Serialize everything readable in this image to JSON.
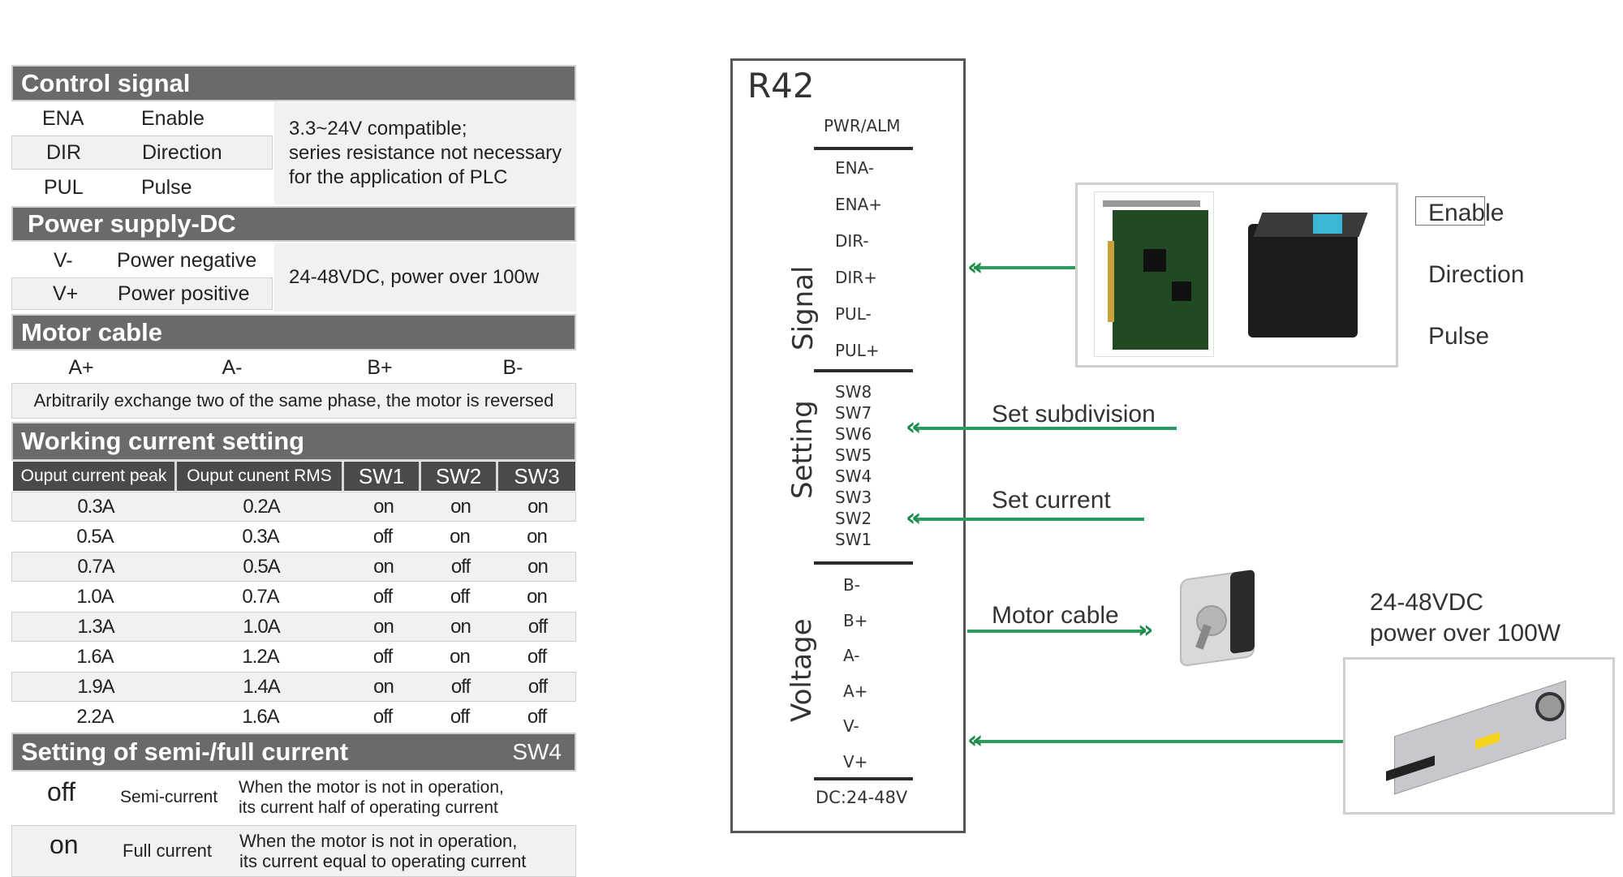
{
  "control_signal": {
    "title": "Control signal",
    "rows": [
      {
        "code": "ENA",
        "name": "Enable"
      },
      {
        "code": "DIR",
        "name": "Direction"
      },
      {
        "code": "PUL",
        "name": "Pulse"
      }
    ],
    "note_lines": [
      "3.3~24V compatible;",
      "series resistance not necessary",
      "for the application of PLC"
    ]
  },
  "power_supply": {
    "title": "Power supply-DC",
    "rows": [
      {
        "code": "V-",
        "name": "Power negative"
      },
      {
        "code": "V+",
        "name": "Power positive"
      }
    ],
    "note": "24-48VDC, power over 100w"
  },
  "motor_cable": {
    "title": "Motor cable",
    "phases": [
      "A+",
      "A-",
      "B+",
      "B-"
    ],
    "note": "Arbitrarily exchange two of the same phase, the motor is reversed"
  },
  "working_current": {
    "title": "Working current setting",
    "columns": [
      "Ouput current peak",
      "Ouput cunent RMS",
      "SW1",
      "SW2",
      "SW3"
    ],
    "rows": [
      [
        "0.3A",
        "0.2A",
        "on",
        "on",
        "on"
      ],
      [
        "0.5A",
        "0.3A",
        "off",
        "on",
        "on"
      ],
      [
        "0.7A",
        "0.5A",
        "on",
        "off",
        "on"
      ],
      [
        "1.0A",
        "0.7A",
        "off",
        "off",
        "on"
      ],
      [
        "1.3A",
        "1.0A",
        "on",
        "on",
        "off"
      ],
      [
        "1.6A",
        "1.2A",
        "off",
        "on",
        "off"
      ],
      [
        "1.9A",
        "1.4A",
        "on",
        "off",
        "off"
      ],
      [
        "2.2A",
        "1.6A",
        "off",
        "off",
        "off"
      ]
    ]
  },
  "semi_full": {
    "title": "Setting of semi-/full current",
    "switch": "SW4",
    "rows": [
      {
        "state": "off",
        "mode": "Semi-current",
        "desc": [
          "When the motor is not in operation,",
          "its current half of operating current"
        ]
      },
      {
        "state": "on",
        "mode": "Full current",
        "desc": [
          "When the motor is not in operation,",
          "its current equal to operating current"
        ]
      }
    ]
  },
  "driver": {
    "model": "R42",
    "top_label": "PWR/ALM",
    "groups": [
      {
        "label": "Signal",
        "pins": [
          "ENA-",
          "ENA+",
          "DIR-",
          "DIR+",
          "PUL-",
          "PUL+"
        ]
      },
      {
        "label": "Setting",
        "pins": [
          "SW8",
          "SW7",
          "SW6",
          "SW5",
          "SW4",
          "SW3",
          "SW2",
          "SW1"
        ]
      },
      {
        "label": "Voltage",
        "pins": [
          "B-",
          "B+",
          "A-",
          "A+",
          "V-",
          "V+"
        ]
      }
    ],
    "bottom_label": "DC:24-48V"
  },
  "callouts": {
    "controller_labels": [
      "Enable",
      "Direction",
      "Pulse"
    ],
    "set_subdivision": "Set subdivision",
    "set_current": "Set current",
    "motor_cable": "Motor cable",
    "power_lines": [
      "24-48VDC",
      "power over 100W"
    ]
  },
  "icons": {
    "arrow_in": "«",
    "arrow_out": "»",
    "controller_images": [
      "motion-control-card-image",
      "plc-image"
    ],
    "motor_image": "stepper-motor-image",
    "psu_image": "power-supply-image"
  },
  "colors": {
    "section_header": "#6a6a6a",
    "column_header": "#4a4a4a",
    "row_shade": "#f1f1f1",
    "arrow_green": "#2e9a5e"
  }
}
